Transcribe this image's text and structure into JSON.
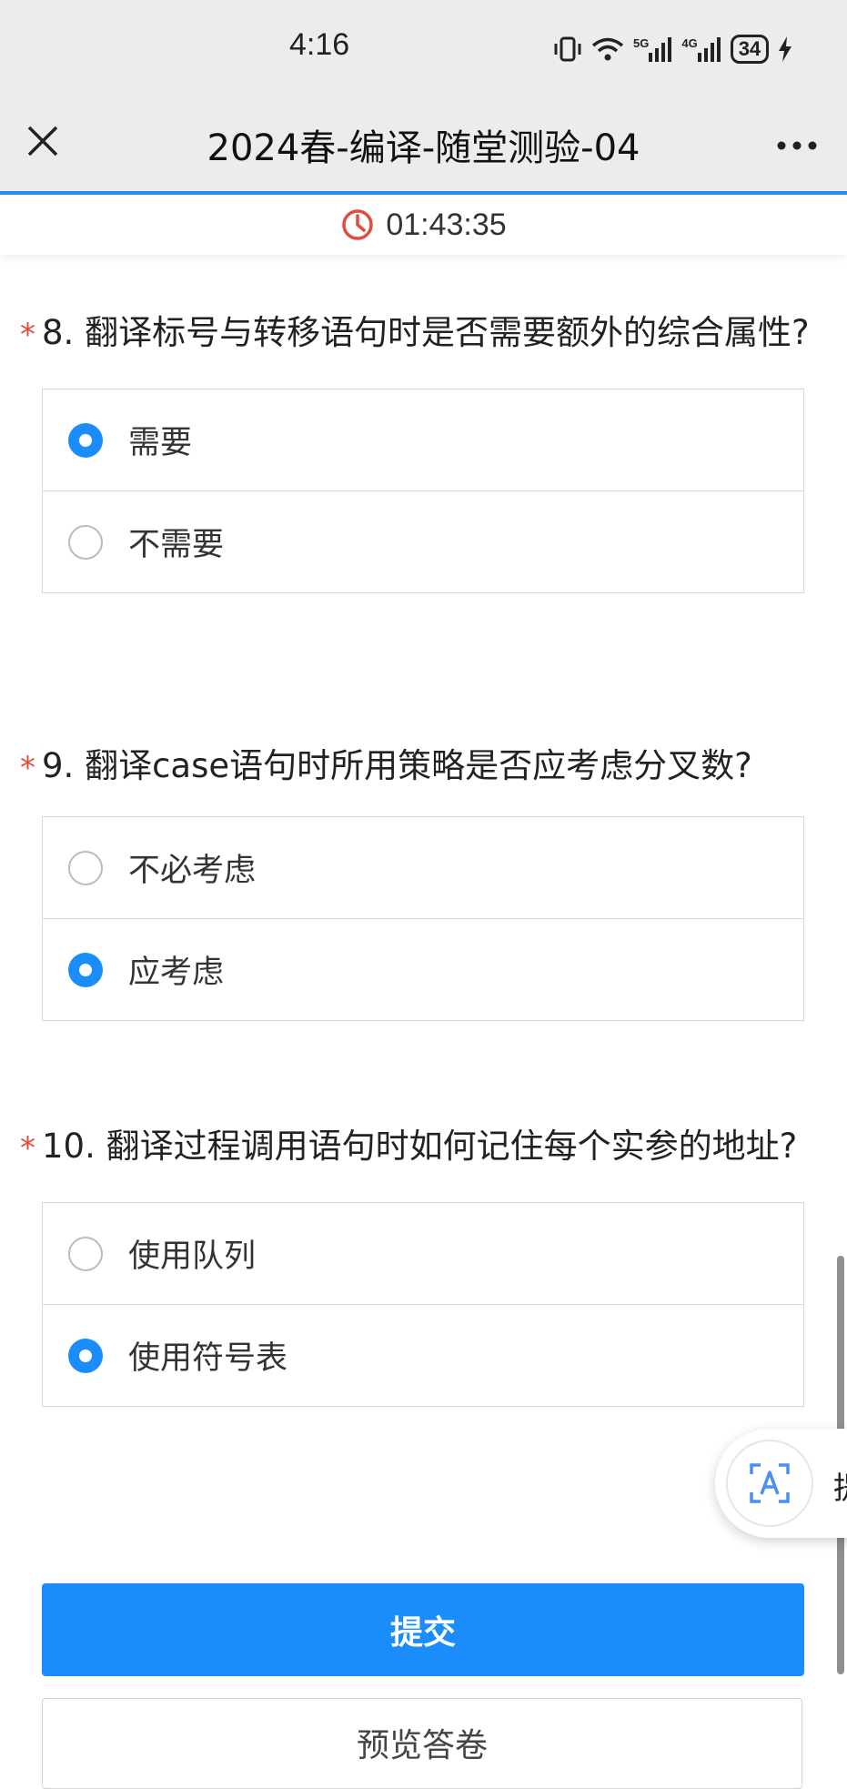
{
  "status_bar": {
    "time": "4:16",
    "signal1_label": "5G",
    "signal2_label": "4G",
    "battery": "34"
  },
  "nav": {
    "title": "2024春-编译-随堂测验-04",
    "close_icon": "close-icon",
    "more_icon": "more-icon"
  },
  "timer": {
    "value": "01:43:35",
    "icon": "clock-icon",
    "color": "#e34a3b"
  },
  "questions": [
    {
      "required_mark": "*",
      "title": "8. 翻译标号与转移语句时是否需要额外的综合属性?",
      "options": [
        {
          "label": "需要",
          "selected": true
        },
        {
          "label": "不需要",
          "selected": false
        }
      ]
    },
    {
      "required_mark": "*",
      "title": "9. 翻译case语句时所用策略是否应考虑分叉数?",
      "options": [
        {
          "label": "不必考虑",
          "selected": false
        },
        {
          "label": "应考虑",
          "selected": true
        }
      ]
    },
    {
      "required_mark": "*",
      "title": "10. 翻译过程调用语句时如何记住每个实参的地址?",
      "options": [
        {
          "label": "使用队列",
          "selected": false
        },
        {
          "label": "使用符号表",
          "selected": true
        }
      ]
    }
  ],
  "actions": {
    "submit_label": "提交",
    "preview_label": "预览答卷"
  },
  "floating_widget": {
    "icon": "text-recognition-icon",
    "text": "提"
  },
  "colors": {
    "accent": "#1a8dfa",
    "required": "#e34a3b",
    "nav_underline": "#2a8cf0"
  }
}
